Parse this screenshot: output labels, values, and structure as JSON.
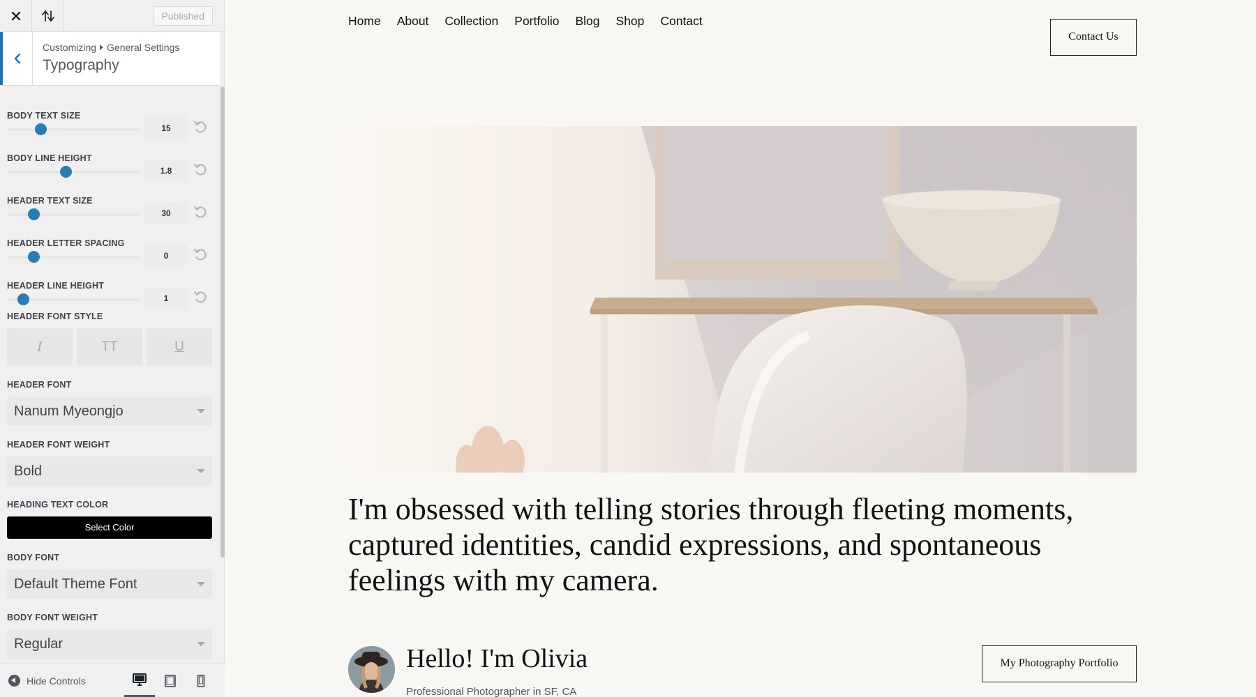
{
  "customizer": {
    "status_label": "Published",
    "breadcrumb": [
      "Customizing",
      "General Settings"
    ],
    "section_title": "Typography",
    "sliders": [
      {
        "label": "BODY TEXT SIZE",
        "value": "15",
        "fraction": 0.25
      },
      {
        "label": "BODY LINE HEIGHT",
        "value": "1.8",
        "fraction": 0.44
      },
      {
        "label": "HEADER TEXT SIZE",
        "value": "30",
        "fraction": 0.2
      },
      {
        "label": "HEADER LETTER SPACING",
        "value": "0",
        "fraction": 0.2
      },
      {
        "label": "HEADER LINE HEIGHT",
        "value": "1",
        "fraction": 0.12
      }
    ],
    "font_style": {
      "label": "HEADER FONT STYLE",
      "buttons": [
        "I",
        "TT",
        "U"
      ]
    },
    "header_font": {
      "label": "HEADER FONT",
      "value": "Nanum Myeongjo"
    },
    "header_font_weight": {
      "label": "HEADER FONT WEIGHT",
      "value": "Bold"
    },
    "heading_color": {
      "label": "HEADING TEXT COLOR",
      "button": "Select Color",
      "color": "#000000"
    },
    "body_font": {
      "label": "BODY FONT",
      "value": "Default Theme Font"
    },
    "body_font_weight": {
      "label": "BODY FONT WEIGHT",
      "value": "Regular"
    },
    "footer": {
      "hide_label": "Hide Controls"
    }
  },
  "site": {
    "nav": [
      "Home",
      "About",
      "Collection",
      "Portfolio",
      "Blog",
      "Shop",
      "Contact"
    ],
    "contact_button": "Contact Us",
    "headline": "I'm obsessed with telling stories through fleeting moments, captured identities, candid expressions, and spontaneous feelings with my camera.",
    "greeting": "Hello! I'm Olivia",
    "subtitle": "Professional Photographer in SF, CA",
    "portfolio_button": "My Photography Portfolio"
  },
  "colors": {
    "accent": "#2b7cb2",
    "admin_blue": "#2271b1"
  }
}
